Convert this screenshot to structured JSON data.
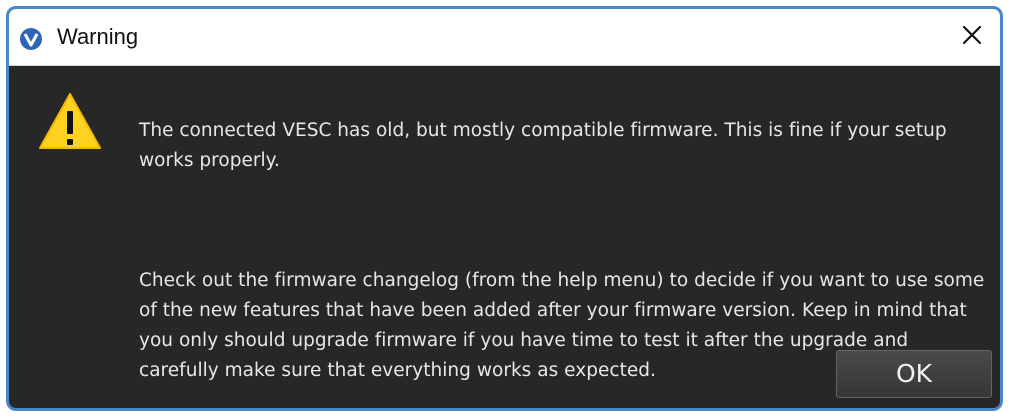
{
  "dialog": {
    "title": "Warning",
    "icons": {
      "app": "vesc-app-icon",
      "warning": "warning-triangle-icon",
      "close": "close-icon"
    },
    "paragraphs": [
      "The connected VESC has old, but mostly compatible firmware. This is fine if your setup works properly.",
      "Check out the firmware changelog (from the help menu) to decide if you want to use some of the new features that have been added after your firmware version. Keep in mind that you only should upgrade firmware if you have time to test it after the upgrade and carefully make sure that everything works as expected."
    ],
    "ok_label": "OK",
    "colors": {
      "window_border": "#4a86c5",
      "body_background": "#272727",
      "text": "#e7e7e7",
      "warning_yellow": "#ffd21f"
    }
  }
}
